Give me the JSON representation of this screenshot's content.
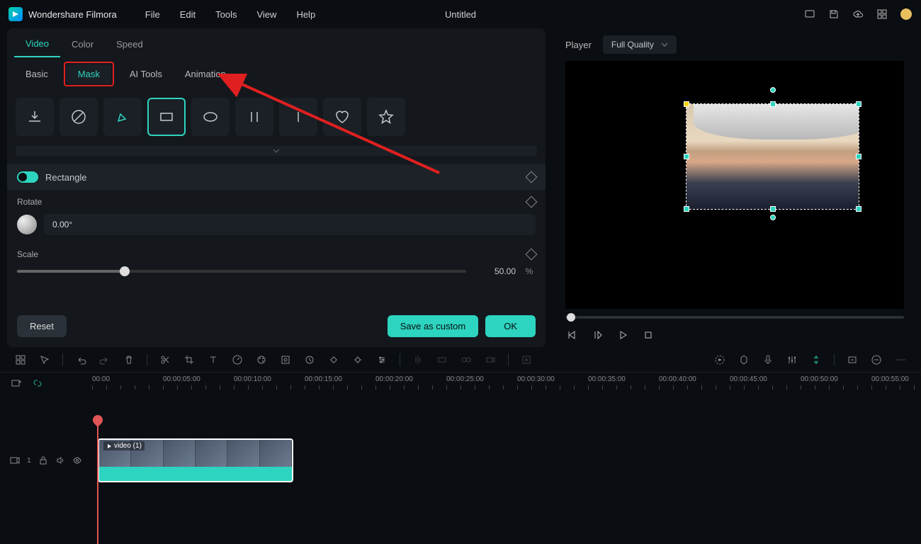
{
  "app": {
    "name": "Wondershare Filmora",
    "doc": "Untitled"
  },
  "menu": [
    "File",
    "Edit",
    "Tools",
    "View",
    "Help"
  ],
  "tabs1": [
    "Video",
    "Color",
    "Speed"
  ],
  "tabs1_active": 0,
  "tabs2": [
    "Basic",
    "Mask",
    "AI Tools",
    "Animation"
  ],
  "tabs2_active": 1,
  "mask": {
    "section": "Rectangle",
    "rotate": {
      "label": "Rotate",
      "value": "0.00°"
    },
    "scale": {
      "label": "Scale",
      "value": "50.00",
      "unit": "%",
      "pct": 24
    }
  },
  "footer": {
    "reset": "Reset",
    "save": "Save as custom",
    "ok": "OK"
  },
  "player": {
    "label": "Player",
    "quality": "Full Quality"
  },
  "timeline": {
    "marks": [
      "00:00",
      "00:00:05:00",
      "00:00:10:00",
      "00:00:15:00",
      "00:00:20:00",
      "00:00:25:00",
      "00:00:30:00",
      "00:00:35:00",
      "00:00:40:00",
      "00:00:45:00",
      "00:00:50:00",
      "00:00:55:00"
    ],
    "clip_label": "video (1)",
    "track_id": "1"
  }
}
